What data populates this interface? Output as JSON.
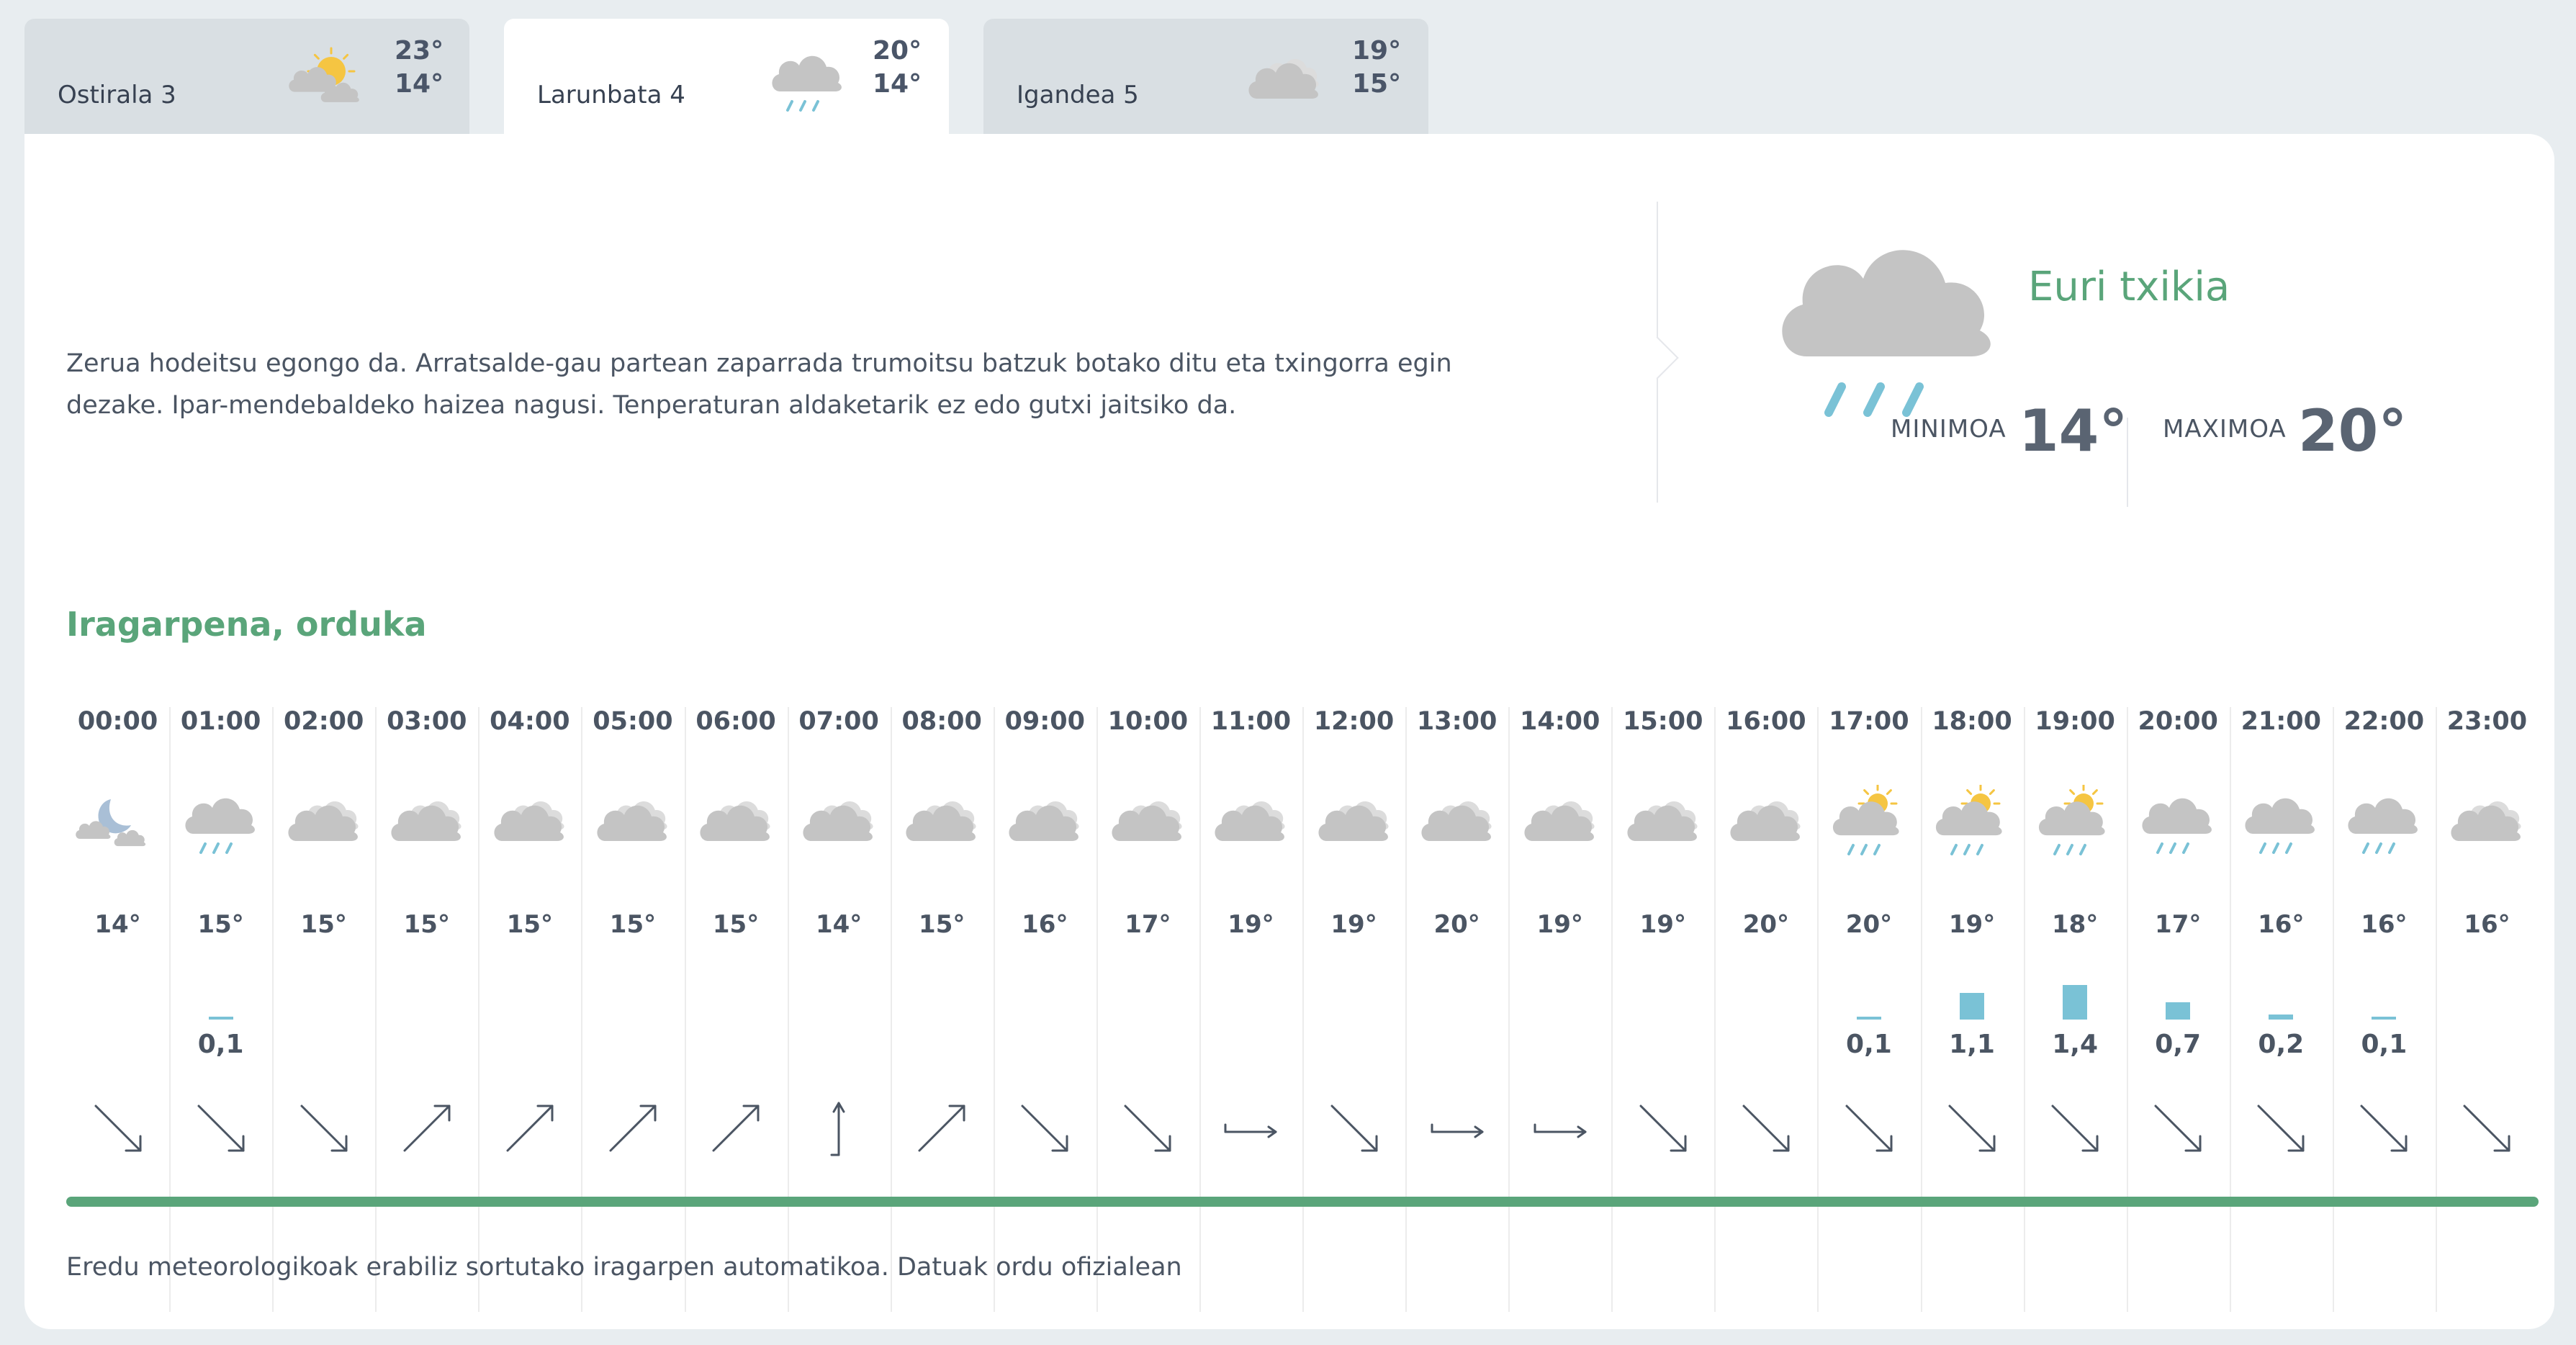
{
  "tabs": [
    {
      "day": "Ostirala 3",
      "max": "23°",
      "min": "14°",
      "icon": "sun-cloud-icon",
      "active": false
    },
    {
      "day": "Larunbata 4",
      "max": "20°",
      "min": "14°",
      "icon": "cloud-rain-icon",
      "active": true
    },
    {
      "day": "Igandea 5",
      "max": "19°",
      "min": "15°",
      "icon": "cloud-icon",
      "active": false
    }
  ],
  "summary": {
    "description": "Zerua hodeitsu egongo da. Arratsalde-gau partean zaparrada trumoitsu batzuk botako ditu eta txingorra egin dezake. Ipar-mendebaldeko haizea nagusi. Tenperaturan aldaketarik ez edo gutxi jaitsiko da.",
    "condition": "Euri txikia",
    "icon": "cloud-rain-icon",
    "min_label": "MINIMOA",
    "min_value": "14°",
    "max_label": "MAXIMOA",
    "max_value": "20°"
  },
  "hourly_title": "Iragarpena, orduka",
  "hours": [
    {
      "time": "00:00",
      "icon": "moon-cloud-icon",
      "temp": "14°",
      "precip": "",
      "precip_mm": 0,
      "wind": "se"
    },
    {
      "time": "01:00",
      "icon": "cloud-rain-icon",
      "temp": "15°",
      "precip": "0,1",
      "precip_mm": 0.1,
      "wind": "se"
    },
    {
      "time": "02:00",
      "icon": "cloud-icon",
      "temp": "15°",
      "precip": "",
      "precip_mm": 0,
      "wind": "se"
    },
    {
      "time": "03:00",
      "icon": "cloud-icon",
      "temp": "15°",
      "precip": "",
      "precip_mm": 0,
      "wind": "ne"
    },
    {
      "time": "04:00",
      "icon": "cloud-icon",
      "temp": "15°",
      "precip": "",
      "precip_mm": 0,
      "wind": "ne"
    },
    {
      "time": "05:00",
      "icon": "cloud-icon",
      "temp": "15°",
      "precip": "",
      "precip_mm": 0,
      "wind": "ne"
    },
    {
      "time": "06:00",
      "icon": "cloud-icon",
      "temp": "15°",
      "precip": "",
      "precip_mm": 0,
      "wind": "ne"
    },
    {
      "time": "07:00",
      "icon": "cloud-icon",
      "temp": "14°",
      "precip": "",
      "precip_mm": 0,
      "wind": "n"
    },
    {
      "time": "08:00",
      "icon": "cloud-icon",
      "temp": "15°",
      "precip": "",
      "precip_mm": 0,
      "wind": "ne"
    },
    {
      "time": "09:00",
      "icon": "cloud-icon",
      "temp": "16°",
      "precip": "",
      "precip_mm": 0,
      "wind": "se"
    },
    {
      "time": "10:00",
      "icon": "cloud-icon",
      "temp": "17°",
      "precip": "",
      "precip_mm": 0,
      "wind": "se"
    },
    {
      "time": "11:00",
      "icon": "cloud-icon",
      "temp": "19°",
      "precip": "",
      "precip_mm": 0,
      "wind": "e"
    },
    {
      "time": "12:00",
      "icon": "cloud-icon",
      "temp": "19°",
      "precip": "",
      "precip_mm": 0,
      "wind": "se"
    },
    {
      "time": "13:00",
      "icon": "cloud-icon",
      "temp": "20°",
      "precip": "",
      "precip_mm": 0,
      "wind": "e"
    },
    {
      "time": "14:00",
      "icon": "cloud-icon",
      "temp": "19°",
      "precip": "",
      "precip_mm": 0,
      "wind": "e"
    },
    {
      "time": "15:00",
      "icon": "cloud-icon",
      "temp": "19°",
      "precip": "",
      "precip_mm": 0,
      "wind": "se"
    },
    {
      "time": "16:00",
      "icon": "cloud-icon",
      "temp": "20°",
      "precip": "",
      "precip_mm": 0,
      "wind": "se"
    },
    {
      "time": "17:00",
      "icon": "sun-cloud-rain-icon",
      "temp": "20°",
      "precip": "0,1",
      "precip_mm": 0.1,
      "wind": "se"
    },
    {
      "time": "18:00",
      "icon": "sun-cloud-rain-icon",
      "temp": "19°",
      "precip": "1,1",
      "precip_mm": 1.1,
      "wind": "se"
    },
    {
      "time": "19:00",
      "icon": "sun-cloud-rain-icon",
      "temp": "18°",
      "precip": "1,4",
      "precip_mm": 1.4,
      "wind": "se"
    },
    {
      "time": "20:00",
      "icon": "cloud-rain-icon",
      "temp": "17°",
      "precip": "0,7",
      "precip_mm": 0.7,
      "wind": "se"
    },
    {
      "time": "21:00",
      "icon": "cloud-rain-icon",
      "temp": "16°",
      "precip": "0,2",
      "precip_mm": 0.2,
      "wind": "se"
    },
    {
      "time": "22:00",
      "icon": "cloud-rain-icon",
      "temp": "16°",
      "precip": "0,1",
      "precip_mm": 0.1,
      "wind": "se"
    },
    {
      "time": "23:00",
      "icon": "cloud-icon",
      "temp": "16°",
      "precip": "",
      "precip_mm": 0,
      "wind": "se"
    }
  ],
  "footer": "Eredu meteorologikoak erabiliz sortutako iragarpen automatikoa. Datuak ordu ofizialean",
  "colors": {
    "accent": "#5aa57a",
    "precip_bar": "#7ac2d6",
    "cloud": "#c4c4c4",
    "sun": "#f5c542",
    "wind_arrow": "#4b5563"
  }
}
